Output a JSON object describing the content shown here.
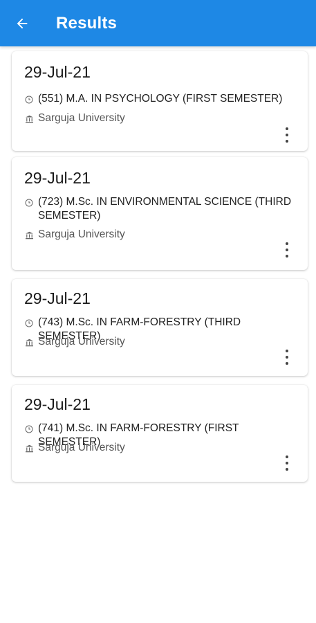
{
  "app_bar": {
    "title": "Results",
    "background": "#1e88e5",
    "back_icon": "arrow-left-icon"
  },
  "results": [
    {
      "date": "29-Jul-21",
      "course": "(551) M.A. IN PSYCHOLOGY (FIRST SEMESTER)",
      "university": "Sarguja University"
    },
    {
      "date": "29-Jul-21",
      "course": "(723) M.Sc. IN ENVIRONMENTAL SCIENCE (THIRD SEMESTER)",
      "university": "Sarguja University"
    },
    {
      "date": "29-Jul-21",
      "course": "(743) M.Sc. IN FARM-FORESTRY (THIRD SEMESTER)",
      "university": "Sarguja University"
    },
    {
      "date": "29-Jul-21",
      "course": "(741) M.Sc. IN FARM-FORESTRY (FIRST SEMESTER)",
      "university": "Sarguja University"
    }
  ],
  "icons": {
    "course": "clock-icon",
    "university": "institution-icon",
    "menu": "more-vertical-icon"
  }
}
